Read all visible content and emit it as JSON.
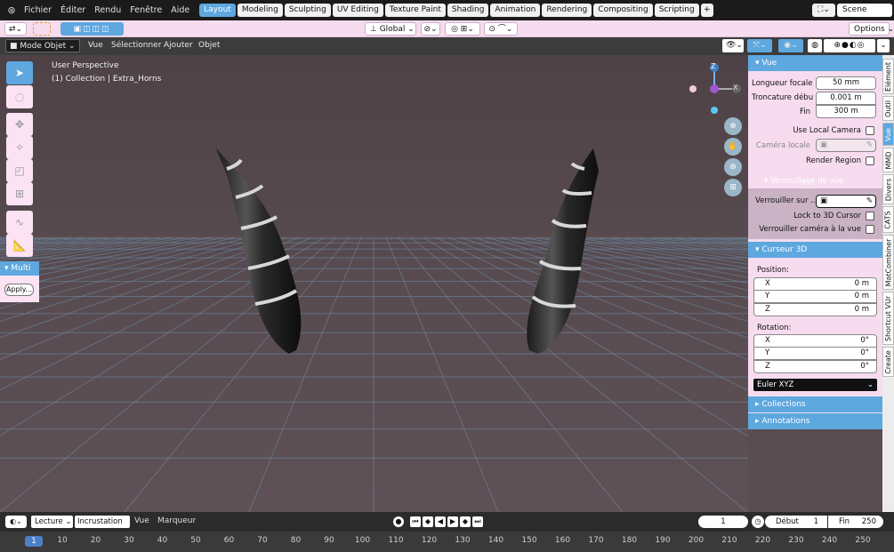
{
  "topbar": {
    "menus": [
      "Fichier",
      "Éditer",
      "Rendu",
      "Fenêtre",
      "Aide"
    ],
    "workspaces": [
      "Layout",
      "Modeling",
      "Sculpting",
      "UV Editing",
      "Texture Paint",
      "Shading",
      "Animation",
      "Rendering",
      "Compositing",
      "Scripting"
    ],
    "active_workspace": "Layout",
    "add_tab": "+",
    "scene": "Scene"
  },
  "header2": {
    "orientation": "Global",
    "options": "Options"
  },
  "header3": {
    "mode": "Mode Objet",
    "items": [
      "Vue",
      "Sélectionner",
      "Ajouter",
      "Objet"
    ]
  },
  "viewport": {
    "perspective": "User Perspective",
    "collection": "(1) Collection | Extra_Horns",
    "gizmo_z": "Z",
    "gizmo_x": "X"
  },
  "operator_panel": {
    "title": "Multi",
    "apply": "Apply..."
  },
  "npanel": {
    "vue_title": "Vue",
    "focal_label": "Longueur focale",
    "focal_value": "50 mm",
    "clip_start_label": "Troncature débu",
    "clip_start_value": "0.001 m",
    "clip_end_label": "Fin",
    "clip_end_value": "300 m",
    "use_local_camera": "Use Local Camera",
    "local_camera": "Caméra locale",
    "render_region": "Render Region",
    "view_lock": "Verrouillage de vue",
    "lock_to": "Verrouiller sur ..",
    "lock_cursor": "Lock to 3D Cursor",
    "lock_camera": "Verrouiller caméra à la vue",
    "cursor_title": "Curseur 3D",
    "position_label": "Position:",
    "position": [
      {
        "k": "X",
        "v": "0 m"
      },
      {
        "k": "Y",
        "v": "0 m"
      },
      {
        "k": "Z",
        "v": "0 m"
      }
    ],
    "rotation_label": "Rotation:",
    "rotation": [
      {
        "k": "X",
        "v": "0°"
      },
      {
        "k": "Y",
        "v": "0°"
      },
      {
        "k": "Z",
        "v": "0°"
      }
    ],
    "rotation_mode": "Euler XYZ",
    "collections": "Collections",
    "annotations": "Annotations"
  },
  "ntabs": [
    "Élément",
    "Outil",
    "Vue",
    "MMD",
    "Divers",
    "CATS",
    "MatCombiner",
    "Shortcut VUr",
    "Create"
  ],
  "timeline": {
    "playback": "Lecture",
    "keying": "Incrustation",
    "view": "Vue",
    "marker": "Marqueur",
    "current_frame": "1",
    "start_label": "Début",
    "start_value": "1",
    "end_label": "Fin",
    "end_value": "250",
    "frames": [
      "1",
      "10",
      "20",
      "30",
      "40",
      "50",
      "60",
      "70",
      "80",
      "90",
      "100",
      "110",
      "120",
      "130",
      "140",
      "150",
      "160",
      "170",
      "180",
      "190",
      "200",
      "210",
      "220",
      "230",
      "240",
      "250"
    ]
  }
}
